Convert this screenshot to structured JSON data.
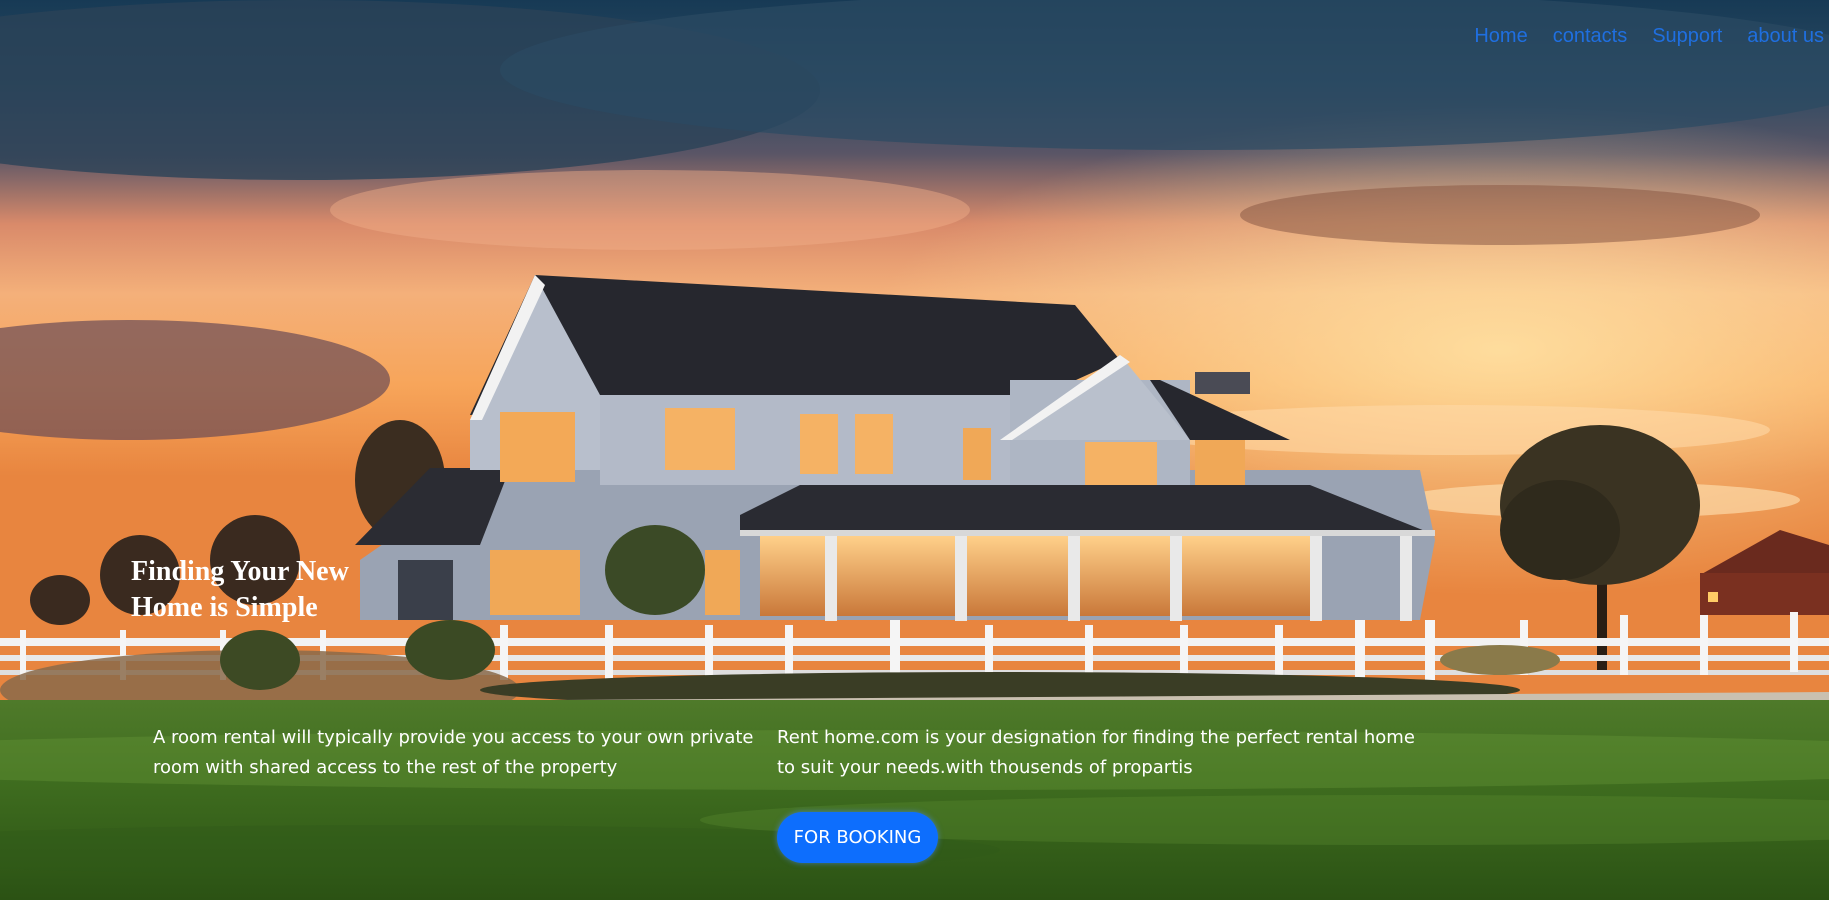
{
  "nav": {
    "items": [
      {
        "label": "Home"
      },
      {
        "label": "contacts"
      },
      {
        "label": "Support"
      },
      {
        "label": "about us"
      }
    ]
  },
  "hero": {
    "headline": "Finding Your New Home is Simple",
    "left_text": "A room rental will typically provide you access to your own private room with shared access to the rest of the property",
    "right_text": "Rent home.com is your designation for finding the perfect rental home to suit your needs.with thousends of propartis",
    "cta_label": "FOR BOOKING"
  },
  "colors": {
    "nav_link": "#1f6fe0",
    "cta_background": "#0d6efd",
    "hero_text": "#ffffff"
  }
}
